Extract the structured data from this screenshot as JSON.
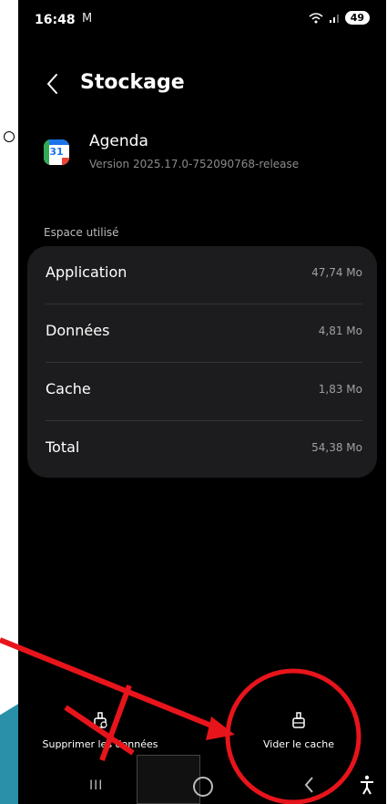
{
  "status": {
    "time": "16:48",
    "mail": "M",
    "battery": "49"
  },
  "header": {
    "title": "Stockage"
  },
  "app": {
    "name": "Agenda",
    "version": "Version 2025.17.0-752090768-release",
    "icon_day": "31"
  },
  "storage": {
    "section_label": "Espace utilisé",
    "rows": [
      {
        "label": "Application",
        "value": "47,74 Mo"
      },
      {
        "label": "Données",
        "value": "4,81 Mo"
      },
      {
        "label": "Cache",
        "value": "1,83 Mo"
      },
      {
        "label": "Total",
        "value": "54,38 Mo"
      }
    ]
  },
  "actions": {
    "clear_data": "Supprimer les données",
    "clear_cache": "Vider le cache"
  },
  "nav": {
    "recents": "III"
  },
  "annotation": {
    "color": "#e8141b",
    "background": "#2a8fa8"
  }
}
